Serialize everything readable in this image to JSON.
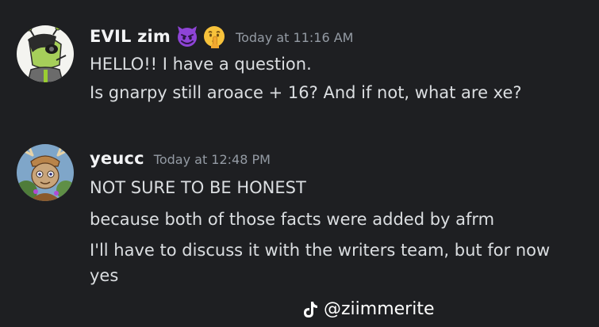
{
  "messages": [
    {
      "author": "EVIL zim",
      "emojis": [
        "smiling-imp-icon",
        "shushing-face-icon"
      ],
      "timestamp": "Today at 11:16 AM",
      "lines": [
        "HELLO!! I have a question.",
        "Is gnarpy still aroace + 16? And if not, what are xe?"
      ]
    },
    {
      "author": "yeucc",
      "timestamp": "Today at 12:48 PM",
      "lines": [
        "NOT SURE TO BE HONEST",
        "because both of those facts were added by afrm",
        "I'll have to discuss it with the writers team, but for now yes"
      ]
    }
  ],
  "watermark": {
    "icon": "tiktok-icon",
    "text": "@ziimmerite"
  },
  "colors": {
    "background": "#1e1f22",
    "username": "#f2f3f5",
    "message_text": "#dbdee1",
    "timestamp": "#949ba4"
  }
}
